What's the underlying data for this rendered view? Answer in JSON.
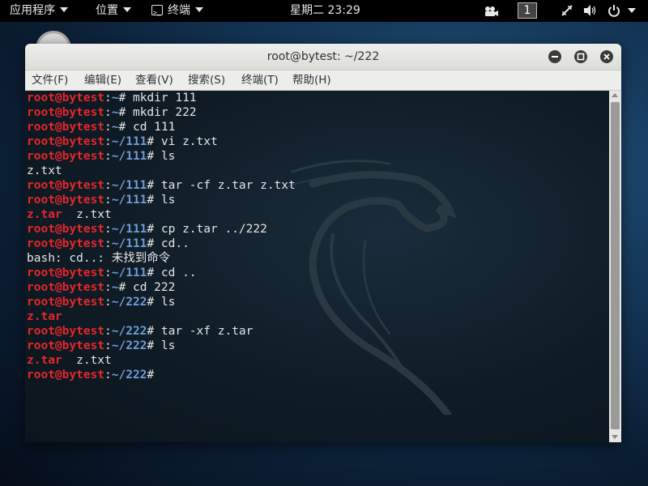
{
  "topbar": {
    "applications": "应用程序",
    "places": "位置",
    "terminal_app": "终端",
    "clock": "星期二 23:29",
    "workspace": "1"
  },
  "window": {
    "title": "root@bytest: ~/222",
    "menu": [
      "文件(F)",
      "编辑(E)",
      "查看(V)",
      "搜索(S)",
      "终端(T)",
      "帮助(H)"
    ]
  },
  "terminal": {
    "prompt_user": "root@bytest",
    "lines": [
      {
        "path": "~",
        "cmd": " mkdir 111"
      },
      {
        "path": "~",
        "cmd": " mkdir 222"
      },
      {
        "path": "~",
        "cmd": " cd 111"
      },
      {
        "path": "~/111",
        "cmd": " vi z.txt"
      },
      {
        "path": "~/111",
        "cmd": " ls"
      },
      {
        "out": "z.txt"
      },
      {
        "path": "~/111",
        "cmd": " tar -cf z.tar z.txt"
      },
      {
        "path": "~/111",
        "cmd": " ls"
      },
      {
        "archive": "z.tar",
        "rest": "  z.txt"
      },
      {
        "path": "~/111",
        "cmd": " cp z.tar ../222"
      },
      {
        "path": "~/111",
        "cmd": " cd.."
      },
      {
        "out": "bash: cd..: 未找到命令"
      },
      {
        "path": "~/111",
        "cmd": " cd .."
      },
      {
        "path": "~",
        "cmd": " cd 222"
      },
      {
        "path": "~/222",
        "cmd": " ls"
      },
      {
        "archive": "z.tar",
        "rest": ""
      },
      {
        "path": "~/222",
        "cmd": " tar -xf z.tar"
      },
      {
        "path": "~/222",
        "cmd": " ls"
      },
      {
        "archive": "z.tar",
        "rest": "  z.txt"
      },
      {
        "path": "~/222",
        "cmd": ""
      }
    ]
  },
  "colors": {
    "prompt_user": "#e5272b",
    "prompt_path": "#6f9dd8",
    "archive": "#e5272b",
    "text": "#e6e6e6",
    "terminal_bg": "#0f1c26"
  },
  "icons": {
    "topbar_right": [
      "camera-icon",
      "network-icon",
      "volume-icon",
      "power-icon"
    ],
    "window_buttons": [
      "minimize-icon",
      "maximize-icon",
      "close-icon"
    ]
  }
}
